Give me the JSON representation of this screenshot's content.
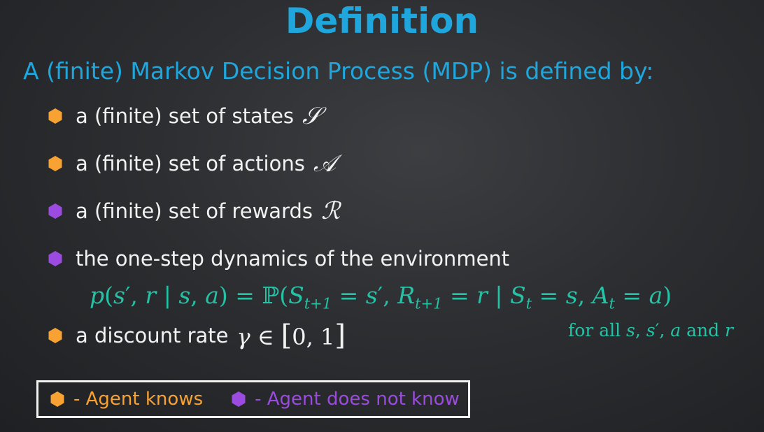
{
  "title": "Definition",
  "subtitle": "A (finite) Markov Decision Process (MDP) is defined by:",
  "colors": {
    "title": "#1fa6dc",
    "agent_knows": "#f7a233",
    "agent_does_not_know": "#9c4be0",
    "formula": "#25c2a6",
    "text": "#f2f2f2"
  },
  "items": [
    {
      "text": "a (finite) set of states",
      "symbol": "𝒮",
      "marker": "orange"
    },
    {
      "text": "a (finite) set of actions",
      "symbol": "𝒜",
      "marker": "orange"
    },
    {
      "text": "a (finite) set of rewards",
      "symbol": "ℛ",
      "marker": "purple"
    },
    {
      "text": "the one-step dynamics of the environment",
      "marker": "purple"
    },
    {
      "text": "a discount rate",
      "marker": "orange"
    }
  ],
  "dynamics_formula": "p(s′, r | s, a) = ℙ(S_{t+1} = s′, R_{t+1} = r | S_t = s, A_t = a)",
  "discount_formula": "γ ∈ [0, 1]",
  "formula_note": "for all s, s′, a and r",
  "legend": [
    {
      "marker": "orange",
      "label": "- Agent knows"
    },
    {
      "marker": "purple",
      "label": "- Agent does not know"
    }
  ]
}
